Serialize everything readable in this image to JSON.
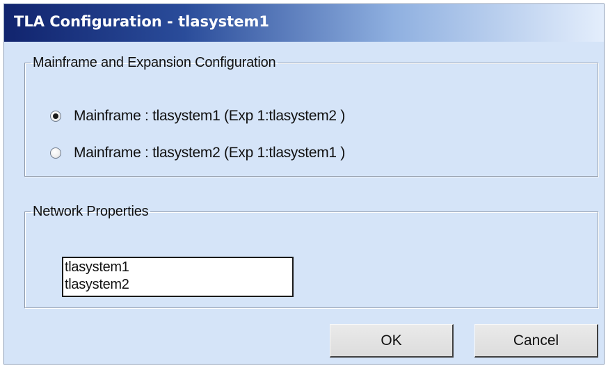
{
  "window": {
    "title": "TLA Configuration - tlasystem1"
  },
  "mainframe_group": {
    "label": "Mainframe and Expansion Configuration",
    "options": [
      {
        "label": "Mainframe : tlasystem1 (Exp 1:tlasystem2 )",
        "checked": true
      },
      {
        "label": "Mainframe : tlasystem2 (Exp 1:tlasystem1 )",
        "checked": false
      }
    ]
  },
  "network_group": {
    "label": "Network Properties",
    "items": [
      "tlasystem1",
      "tlasystem2"
    ]
  },
  "buttons": {
    "ok_label": "OK",
    "cancel_label": "Cancel"
  },
  "colors": {
    "dialog_background": "#d5e4f8",
    "titlebar_start": "#11246e",
    "titlebar_end": "#e4eefc"
  }
}
